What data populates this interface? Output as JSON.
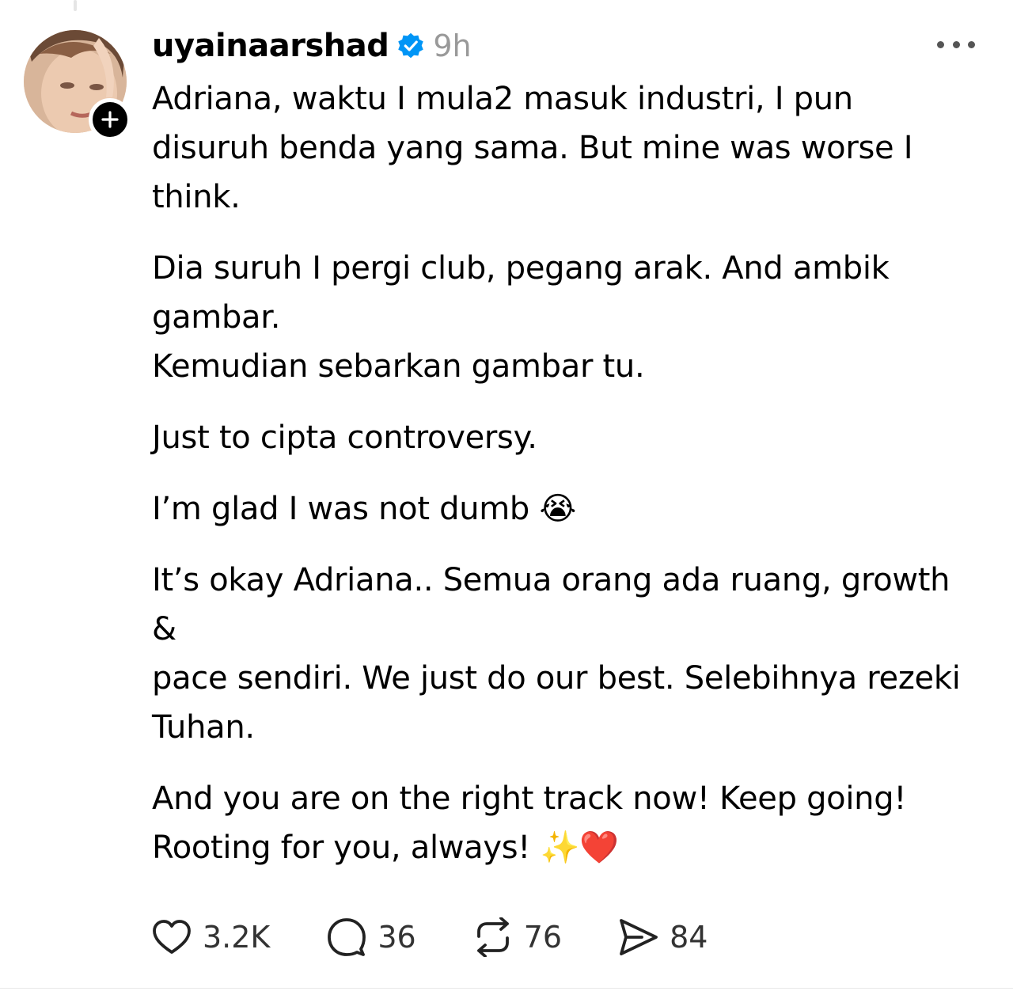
{
  "post": {
    "username": "uyainaarshad",
    "timestamp": "9h",
    "verified": true,
    "paragraphs": [
      "Adriana, waktu I mula2 masuk industri, I pun disuruh benda yang sama. But mine was worse I think.",
      "Dia suruh I pergi club, pegang arak. And ambik gambar.\nKemudian sebarkan gambar tu.",
      "Just to cipta controversy.",
      "I’m glad I was not dumb 😭",
      "It’s okay Adriana.. Semua orang ada ruang, growth &\npace sendiri. We just do our best. Selebihnya rezeki Tuhan.",
      "And you are on the right track now! Keep going! Rooting for you, always! ✨❤️"
    ]
  },
  "actions": {
    "likes": "3.2K",
    "replies": "36",
    "reposts": "76",
    "shares": "84"
  },
  "icons": {
    "verified": "verified-badge-icon",
    "follow": "plus-icon",
    "more": "more-options-icon",
    "like": "heart-icon",
    "reply": "speech-bubble-icon",
    "repost": "repost-arrows-icon",
    "share": "paper-plane-icon"
  },
  "colors": {
    "verified_blue": "#0095f6",
    "text": "#000000",
    "muted": "#999999"
  }
}
